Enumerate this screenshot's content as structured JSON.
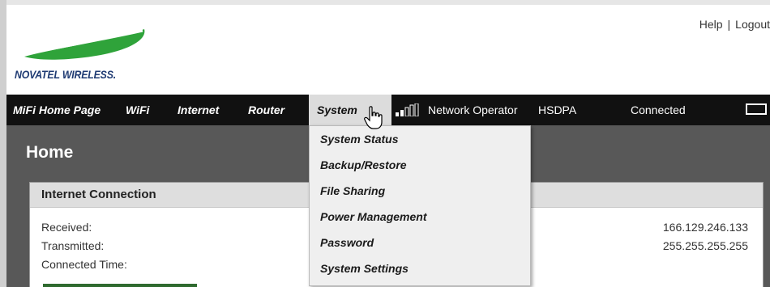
{
  "header": {
    "brand": "NOVATEL WIRELESS.",
    "help_link": "Help",
    "separator": "|",
    "logout_link": "Logout"
  },
  "nav": {
    "items": [
      "MiFi Home Page",
      "WiFi",
      "Internet",
      "Router",
      "System"
    ],
    "network_operator": "Network Operator",
    "network_type": "HSDPA",
    "connection_status": "Connected"
  },
  "system_menu": {
    "items": [
      "System Status",
      "Backup/Restore",
      "File Sharing",
      "Power Management",
      "Password",
      "System Settings"
    ]
  },
  "main": {
    "page_title": "Home",
    "panel": {
      "title": "Internet Connection",
      "rows": [
        {
          "label": "Received:",
          "value": "166.129.246.133"
        },
        {
          "label": "Transmitted:",
          "value": "255.255.255.255"
        },
        {
          "label": "Connected Time:",
          "value": ""
        }
      ]
    }
  },
  "colors": {
    "nav_bg": "#111111",
    "content_bg": "#585858",
    "logo_green": "#2fa33a",
    "brand_blue": "#1f3b73"
  }
}
